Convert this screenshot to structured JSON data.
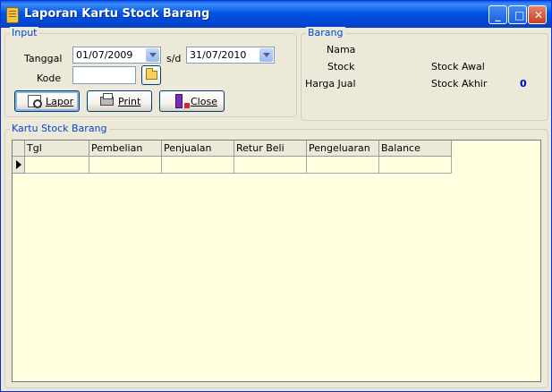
{
  "window": {
    "title": "Laporan Kartu Stock Barang",
    "controls": {
      "minimize": "_",
      "maximize": "□",
      "close": "✕"
    }
  },
  "input_group": {
    "title": "Input",
    "tanggal_label": "Tanggal",
    "date_from": "01/07/2009",
    "sd_label": "s/d",
    "date_to": "31/07/2010",
    "kode_label": "Kode",
    "kode_value": ""
  },
  "buttons": {
    "lapor": "Lapor",
    "print": "Print",
    "close": "Close"
  },
  "barang_group": {
    "title": "Barang",
    "nama_label": "Nama",
    "stock_label": "Stock",
    "harga_jual_label": "Harga Jual",
    "stock_awal_label": "Stock Awal",
    "stock_akhir_label": "Stock Akhir",
    "stock_akhir_value": "0"
  },
  "kartu_group": {
    "title": "Kartu Stock Barang",
    "columns": [
      "Tgl",
      "Pembelian",
      "Penjualan",
      "Retur Beli",
      "Pengeluaran",
      "Balance"
    ]
  }
}
